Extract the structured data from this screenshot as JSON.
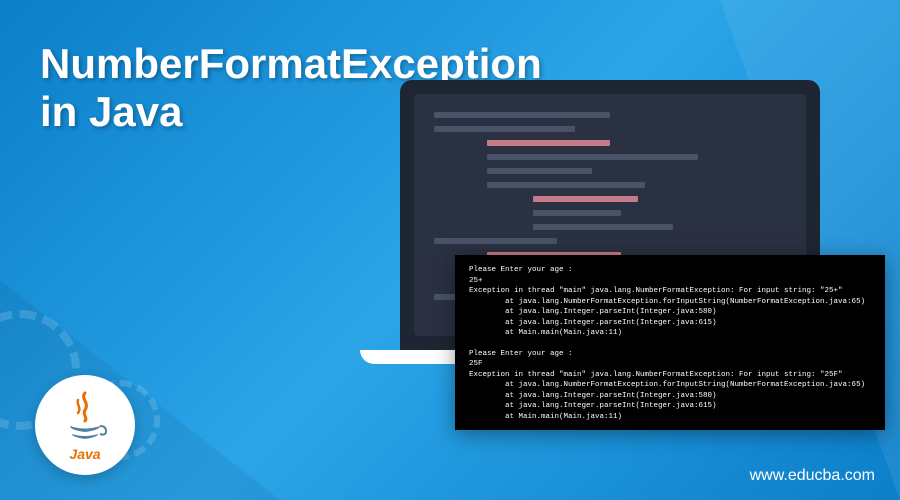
{
  "title_line1": "NumberFormatException",
  "title_line2": "in Java",
  "logo": {
    "text": "Java"
  },
  "website": "www.educba.com",
  "terminal": {
    "block1": {
      "prompt": "Please Enter your age :",
      "input": "25+",
      "exception": "Exception in thread \"main\" java.lang.NumberFormatException: For input string: \"25+\"",
      "trace1": "        at java.lang.NumberFormatException.forInputString(NumberFormatException.java:65)",
      "trace2": "        at java.lang.Integer.parseInt(Integer.java:580)",
      "trace3": "        at java.lang.Integer.parseInt(Integer.java:615)",
      "trace4": "        at Main.main(Main.java:11)"
    },
    "block2": {
      "prompt": "Please Enter your age :",
      "input": "25F",
      "exception": "Exception in thread \"main\" java.lang.NumberFormatException: For input string: \"25F\"",
      "trace1": "        at java.lang.NumberFormatException.forInputString(NumberFormatException.java:65)",
      "trace2": "        at java.lang.Integer.parseInt(Integer.java:580)",
      "trace3": "        at java.lang.Integer.parseInt(Integer.java:615)",
      "trace4": "        at Main.main(Main.java:11)"
    }
  }
}
